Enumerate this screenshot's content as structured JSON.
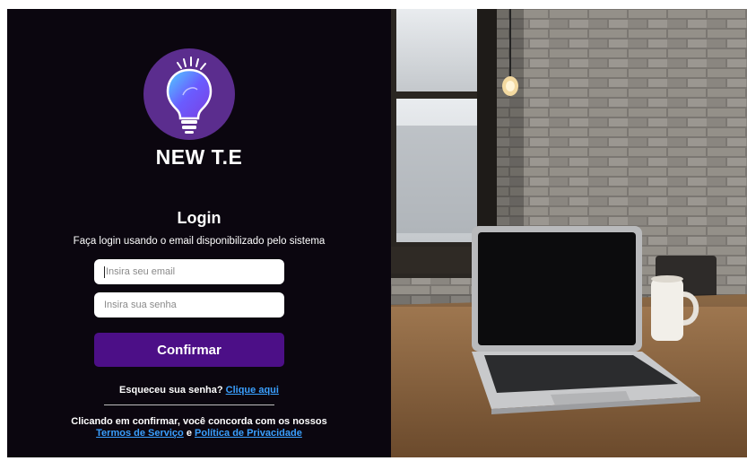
{
  "brand": {
    "name": "NEW T.E",
    "logo_icon": "lightbulb-icon",
    "logo_color": "#5b2d8e"
  },
  "login": {
    "title": "Login",
    "subtitle": "Faça login usando o email disponibilizado pelo sistema",
    "email_placeholder": "Insira seu email",
    "password_placeholder": "Insira sua senha",
    "confirm_label": "Confirmar",
    "forgot_text": "Esqueceu sua senha?",
    "forgot_link": "Clique aqui",
    "terms_text": "Clicando em confirmar, você concorda com os nossos",
    "terms_link": "Termos de Serviço",
    "and_text": "e",
    "privacy_link": "Política de Privacidade"
  },
  "colors": {
    "background": "#0b060f",
    "button": "#4c0f87",
    "link": "#3aa0ff"
  }
}
